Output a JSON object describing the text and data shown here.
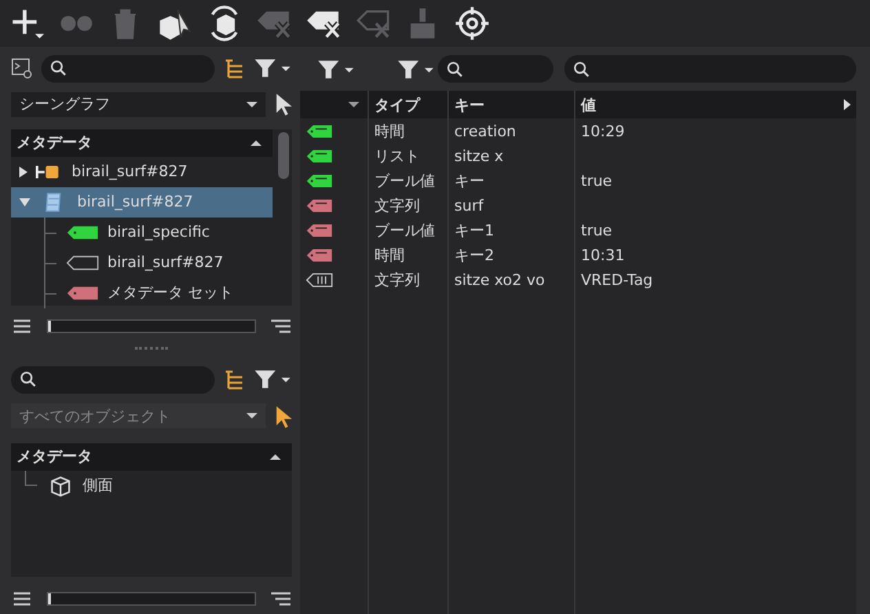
{
  "toolbar": [
    {
      "kind": "add",
      "disabled": false
    },
    {
      "kind": "circles",
      "disabled": true
    },
    {
      "kind": "trash",
      "disabled": true
    },
    {
      "kind": "box-cursor",
      "disabled": false
    },
    {
      "kind": "box-refresh",
      "disabled": false
    },
    {
      "kind": "tag-remove",
      "disabled": true
    },
    {
      "kind": "tag-remove",
      "disabled": false
    },
    {
      "kind": "tag-outline-remove",
      "disabled": true
    },
    {
      "kind": "brush",
      "disabled": true
    },
    {
      "kind": "target",
      "disabled": false
    }
  ],
  "scene_panel": {
    "source": "シーングラフ",
    "header": "メタデータ",
    "tree": [
      {
        "label": "birail_surf#827",
        "kind": "group",
        "expanded": false,
        "selected": false
      },
      {
        "label": "birail_surf#827",
        "kind": "document",
        "expanded": true,
        "selected": true,
        "children": [
          {
            "label": "birail_specific",
            "kind": "tag",
            "color": "#2fd43f",
            "selected": false
          },
          {
            "label": "birail_surf#827",
            "kind": "outline",
            "selected": false
          },
          {
            "label": "メタデータ セット",
            "kind": "tag",
            "color": "#d0707a",
            "selected": false
          }
        ]
      }
    ],
    "zoom": {
      "level": 0
    }
  },
  "object_panel": {
    "source": "すべてのオブジェクト",
    "header": "メタデータ",
    "tree": [
      {
        "label": "側面",
        "kind": "cube",
        "selected": false
      }
    ],
    "zoom": {
      "level": 0
    }
  },
  "table": {
    "columns": [
      "タイプ",
      "キー",
      "値"
    ],
    "rows": [
      {
        "kind": "tag",
        "color": "#2fd43f",
        "type": "時間",
        "key": "creation",
        "value": "10:29"
      },
      {
        "kind": "tag",
        "color": "#2fd43f",
        "type": "リスト",
        "key": "sitze x"
      },
      {
        "kind": "tag",
        "color": "#2fd43f",
        "type": "ブール値",
        "key": "キー",
        "value": "true"
      },
      {
        "kind": "tag",
        "color": "#d0707a",
        "type": "文字列",
        "key": "surf"
      },
      {
        "kind": "tag",
        "color": "#d0707a",
        "type": "ブール値",
        "key": "キー1",
        "value": "true"
      },
      {
        "kind": "tag",
        "color": "#d0707a",
        "type": "時間",
        "key": "キー2",
        "value": "10:31"
      },
      {
        "kind": "outline",
        "type": "文字列",
        "key": "sitze xo2 vo",
        "value": "VRED-Tag"
      }
    ]
  }
}
